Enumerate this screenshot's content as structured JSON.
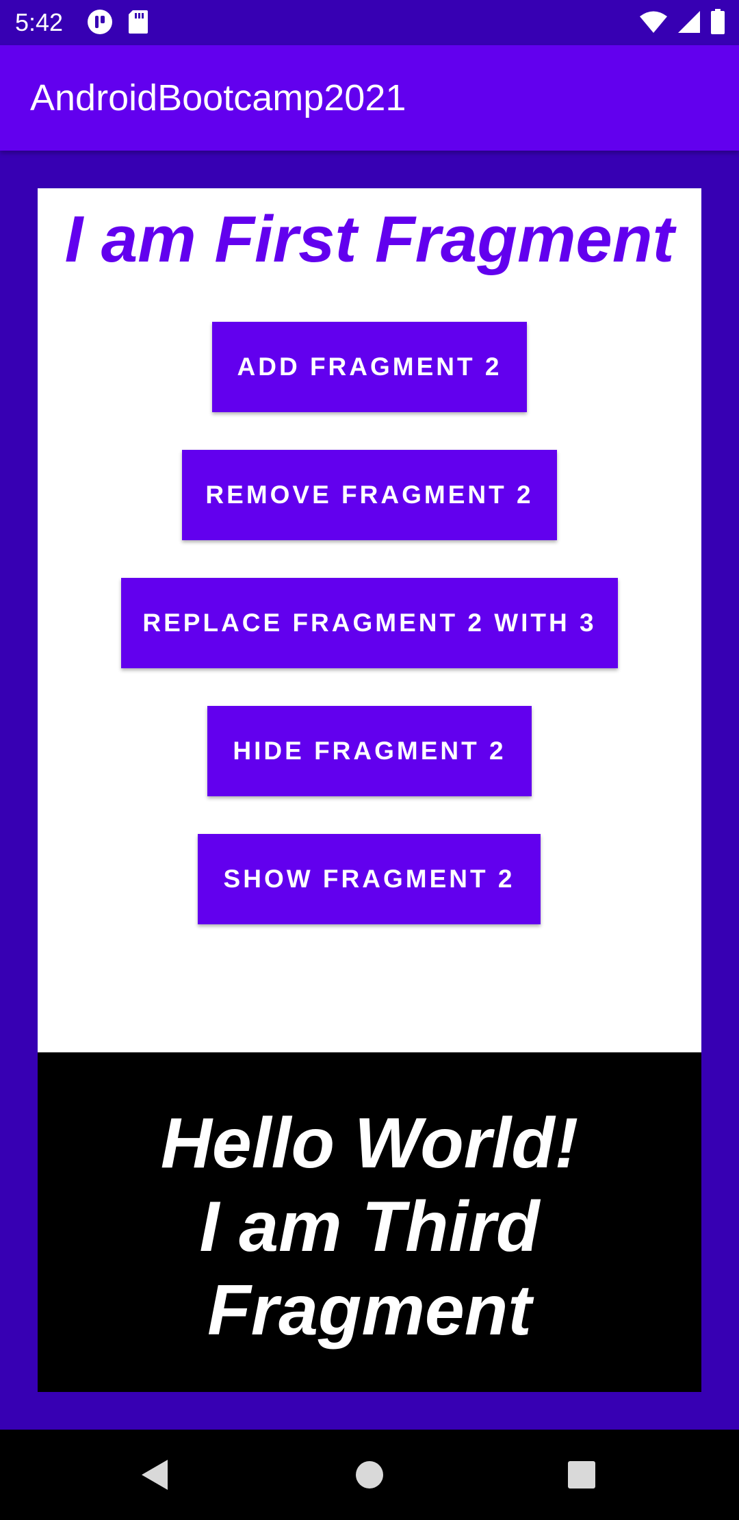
{
  "status_bar": {
    "time": "5:42",
    "left_icons": [
      "app-notification-icon",
      "sd-card-icon"
    ],
    "right_icons": [
      "wifi-icon",
      "cell-signal-icon",
      "battery-icon"
    ]
  },
  "app_bar": {
    "title": "AndroidBootcamp2021"
  },
  "first_fragment": {
    "heading": "I am First Fragment",
    "buttons": {
      "add": "ADD FRAGMENT 2",
      "remove": "REMOVE FRAGMENT 2",
      "replace": "REPLACE FRAGMENT 2 WITH 3",
      "hide": "HIDE FRAGMENT 2",
      "show": "SHOW FRAGMENT 2"
    }
  },
  "third_fragment": {
    "line1": "Hello World!",
    "line2": "I am Third",
    "line3": "Fragment"
  },
  "nav_bar": {
    "icons": [
      "back-icon",
      "home-icon",
      "recents-icon"
    ]
  },
  "colors": {
    "primary": "#6200ee",
    "primary_dark": "#3700b3",
    "fragment_bg": "#ffffff",
    "third_fragment_bg": "#000000"
  }
}
